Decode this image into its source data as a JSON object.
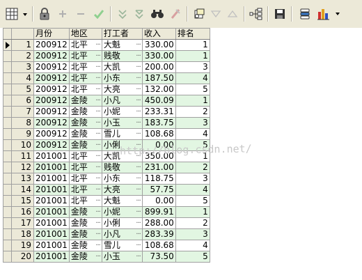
{
  "columns": [
    "月份",
    "地区",
    "打工者",
    "收入",
    "排名"
  ],
  "rows": [
    {
      "row": "1",
      "month": "200912",
      "region": "北平",
      "worker": "大魁",
      "income": "330.00",
      "rank": "1"
    },
    {
      "row": "2",
      "month": "200912",
      "region": "北平",
      "worker": "贱敬",
      "income": "330.00",
      "rank": "1"
    },
    {
      "row": "3",
      "month": "200912",
      "region": "北平",
      "worker": "大凯",
      "income": "200.00",
      "rank": "3"
    },
    {
      "row": "4",
      "month": "200912",
      "region": "北平",
      "worker": "小东",
      "income": "187.50",
      "rank": "4"
    },
    {
      "row": "5",
      "month": "200912",
      "region": "北平",
      "worker": "大亮",
      "income": "132.00",
      "rank": "5"
    },
    {
      "row": "6",
      "month": "200912",
      "region": "金陵",
      "worker": "小凡",
      "income": "450.09",
      "rank": "1"
    },
    {
      "row": "7",
      "month": "200912",
      "region": "金陵",
      "worker": "小妮",
      "income": "233.31",
      "rank": "2"
    },
    {
      "row": "8",
      "month": "200912",
      "region": "金陵",
      "worker": "小玉",
      "income": "183.75",
      "rank": "3"
    },
    {
      "row": "9",
      "month": "200912",
      "region": "金陵",
      "worker": "雪儿",
      "income": "108.68",
      "rank": "4"
    },
    {
      "row": "10",
      "month": "200912",
      "region": "金陵",
      "worker": "小俐",
      "income": "0.00",
      "rank": "5"
    },
    {
      "row": "11",
      "month": "201001",
      "region": "北平",
      "worker": "大凯",
      "income": "350.00",
      "rank": "1"
    },
    {
      "row": "12",
      "month": "201001",
      "region": "北平",
      "worker": "贱敬",
      "income": "231.00",
      "rank": "2"
    },
    {
      "row": "13",
      "month": "201001",
      "region": "北平",
      "worker": "小东",
      "income": "118.75",
      "rank": "3"
    },
    {
      "row": "14",
      "month": "201001",
      "region": "北平",
      "worker": "大亮",
      "income": "57.75",
      "rank": "4"
    },
    {
      "row": "15",
      "month": "201001",
      "region": "北平",
      "worker": "大魁",
      "income": "0.00",
      "rank": "5"
    },
    {
      "row": "16",
      "month": "201001",
      "region": "金陵",
      "worker": "小妮",
      "income": "899.91",
      "rank": "1"
    },
    {
      "row": "17",
      "month": "201001",
      "region": "金陵",
      "worker": "小俐",
      "income": "288.00",
      "rank": "2"
    },
    {
      "row": "18",
      "month": "201001",
      "region": "金陵",
      "worker": "小凡",
      "income": "283.39",
      "rank": "3"
    },
    {
      "row": "19",
      "month": "201001",
      "region": "金陵",
      "worker": "雪儿",
      "income": "108.68",
      "rank": "4"
    },
    {
      "row": "20",
      "month": "201001",
      "region": "金陵",
      "worker": "小玉",
      "income": "73.50",
      "rank": "5"
    }
  ],
  "cell_ellipsis": "···",
  "watermark": "http://blog.csdn.net/",
  "colors": {
    "alt_row": "#e2f6e2",
    "header_bg": "#ece9d8",
    "toolbar_bg": "#ece9d8"
  },
  "toolbar_icons": [
    "grid-menu-icon",
    "lock-icon",
    "add-icon",
    "remove-icon",
    "check-icon",
    "sort-desc-icon",
    "sort-asc-icon",
    "find-icon",
    "clear-icon",
    "print-preview-icon",
    "filter-down-icon",
    "filter-up-icon",
    "tree-icon",
    "save-icon",
    "database-icon",
    "chart-icon"
  ]
}
